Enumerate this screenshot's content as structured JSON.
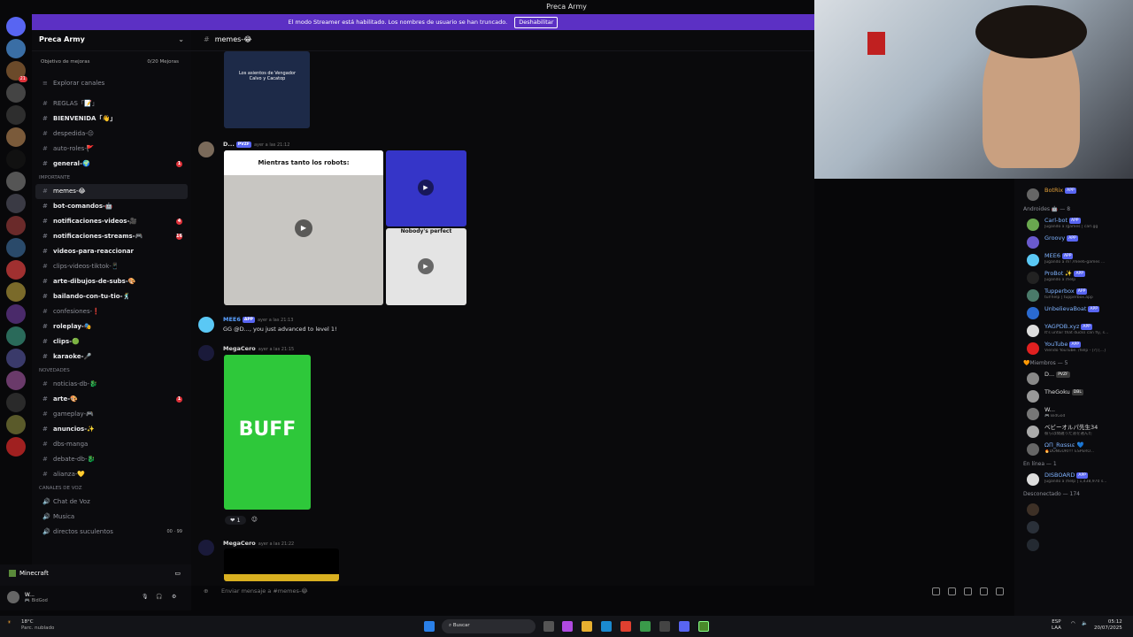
{
  "window": {
    "title": "Preca Army"
  },
  "banner": {
    "text": "El modo Streamer está habilitado. Los nombres de usuario se han truncado.",
    "button": "Deshabilitar"
  },
  "server": {
    "name": "Preca Army",
    "boost_label": "Objetivo de mejoras",
    "boost_value": "0/20 Mejoras",
    "browse": "Explorar canales"
  },
  "channels": [
    {
      "name": "REGLAS「📝」",
      "bold": false
    },
    {
      "name": "BIENVENIDA「👋」",
      "bold": true
    },
    {
      "name": "despedida-😔"
    },
    {
      "name": "auto-roles-🚩"
    },
    {
      "name": "general-🌍",
      "badge": "1",
      "bold": true
    }
  ],
  "cat_important": "IMPORTANTE",
  "channels2": [
    {
      "name": "memes-😂",
      "sel": true
    },
    {
      "name": "bot-comandos-🤖",
      "bold": true
    },
    {
      "name": "notificaciones-videos-🎥",
      "badge": "4",
      "bold": true
    },
    {
      "name": "notificaciones-streams-🎮",
      "badge": "16",
      "bold": true
    },
    {
      "name": "videos-para-reaccionar",
      "bold": true
    },
    {
      "name": "clips-videos-tiktok-📱"
    },
    {
      "name": "arte-dibujos-de-subs-🎨",
      "bold": true
    },
    {
      "name": "bailando-con-tu-tio-🕺",
      "bold": true
    },
    {
      "name": "confesiones-❗"
    },
    {
      "name": "roleplay-🎭",
      "bold": true
    },
    {
      "name": "clips-🟢",
      "bold": true
    },
    {
      "name": "karaoke-🎤",
      "bold": true
    }
  ],
  "cat_news": "Novedades",
  "channels3": [
    {
      "name": "noticias-db-🐉"
    },
    {
      "name": "arte-🎨",
      "badge": "1",
      "bold": true
    },
    {
      "name": "gameplay-🎮"
    },
    {
      "name": "anuncios-✨",
      "bold": true
    },
    {
      "name": "dbs-manga"
    },
    {
      "name": "debate-db-🐉"
    },
    {
      "name": "alianza-💛"
    }
  ],
  "cat_voice": "Canales de voz",
  "voice": [
    {
      "name": "Chat de Voz"
    },
    {
      "name": "Musica"
    },
    {
      "name": "directos suculentos",
      "extra": "00 · 99"
    }
  ],
  "voice_status": "Minecraft",
  "user": {
    "name": "W...",
    "status": "🎮 BidGod"
  },
  "channel_header": "memes-😂",
  "messages": [
    {
      "user": "D...",
      "tag": "PVZF",
      "time": "ayer a las 21:12",
      "media_caption": "Mientras tanto los robots:",
      "media_caption2": "Nobody's perfect",
      "old_caption": "Los asientos de Vengador Calvo y Cacatop"
    },
    {
      "user": "MEE6",
      "tag": "APP",
      "time": "ayer a las 21:13",
      "text": "GG @D..., you just advanced to level 1!"
    },
    {
      "user": "MegaCero",
      "time": "ayer a las 21:15",
      "sticker_text": "BUFF",
      "reaction": "1"
    },
    {
      "user": "MegaCero",
      "time": "ayer a las 21:22"
    }
  ],
  "input_placeholder": "Enviar mensaje a #memes-😂",
  "members": {
    "top": {
      "name": "BotRix",
      "tag": "APP"
    },
    "cat_androids": "Androides 🤖 — 8",
    "androids": [
      {
        "name": "Carl-bot",
        "status": "Jugando a /games | carl.gg",
        "color": "#7fb3ff"
      },
      {
        "name": "Groovy",
        "status": "",
        "color": "#7fb3ff"
      },
      {
        "name": "MEE6",
        "status": "Jugando a m! /mee6-games ...",
        "color": "#7fb3ff"
      },
      {
        "name": "ProBot ✨",
        "status": "Jugando a /help",
        "color": "#7fb3ff"
      },
      {
        "name": "Tupperbox",
        "status": "tul!help | tupperbox.app",
        "color": "#7fb3ff"
      },
      {
        "name": "UnbelievaBoat",
        "status": "",
        "color": "#7fb3ff"
      },
      {
        "name": "YAGPDB.xyz",
        "status": "It's unfair that ducks can fly, s...",
        "color": "#7fb3ff"
      },
      {
        "name": "YouTube",
        "status": "Viendo YouTube. /help - [?] [...]",
        "color": "#7fb3ff"
      }
    ],
    "cat_members": "🧡Miembros — 5",
    "members": [
      {
        "name": "D...",
        "tag2": "PVZF",
        "status": "",
        "color": "#dddddd"
      },
      {
        "name": "TheGoku",
        "tag2": "DBL",
        "status": "",
        "color": "#dddddd"
      },
      {
        "name": "W...",
        "status": "🎮 BidGod",
        "color": "#dddddd"
      },
      {
        "name": "ベビーオルパ先生34",
        "status": "彼らは間違った道を選んだ",
        "color": "#dddddd"
      },
      {
        "name": "ΩΠ_Rαssιε 💙",
        "status": "🔥DONGURI!!! ESPERO...",
        "color": "#7fb3ff"
      }
    ],
    "cat_online": "En línea — 1",
    "online": [
      {
        "name": "DISBOARD",
        "tag": "APP",
        "status": "Jugando a /help | 1,438,970 s..."
      }
    ],
    "cat_offline": "Desconectado — 174"
  },
  "taskbar": {
    "weather": "18°C",
    "weather2": "Parc. nublado",
    "search": "Buscar",
    "lang": "ESP",
    "lang2": "LAA",
    "time": "05:12",
    "date": "20/07/2025"
  }
}
